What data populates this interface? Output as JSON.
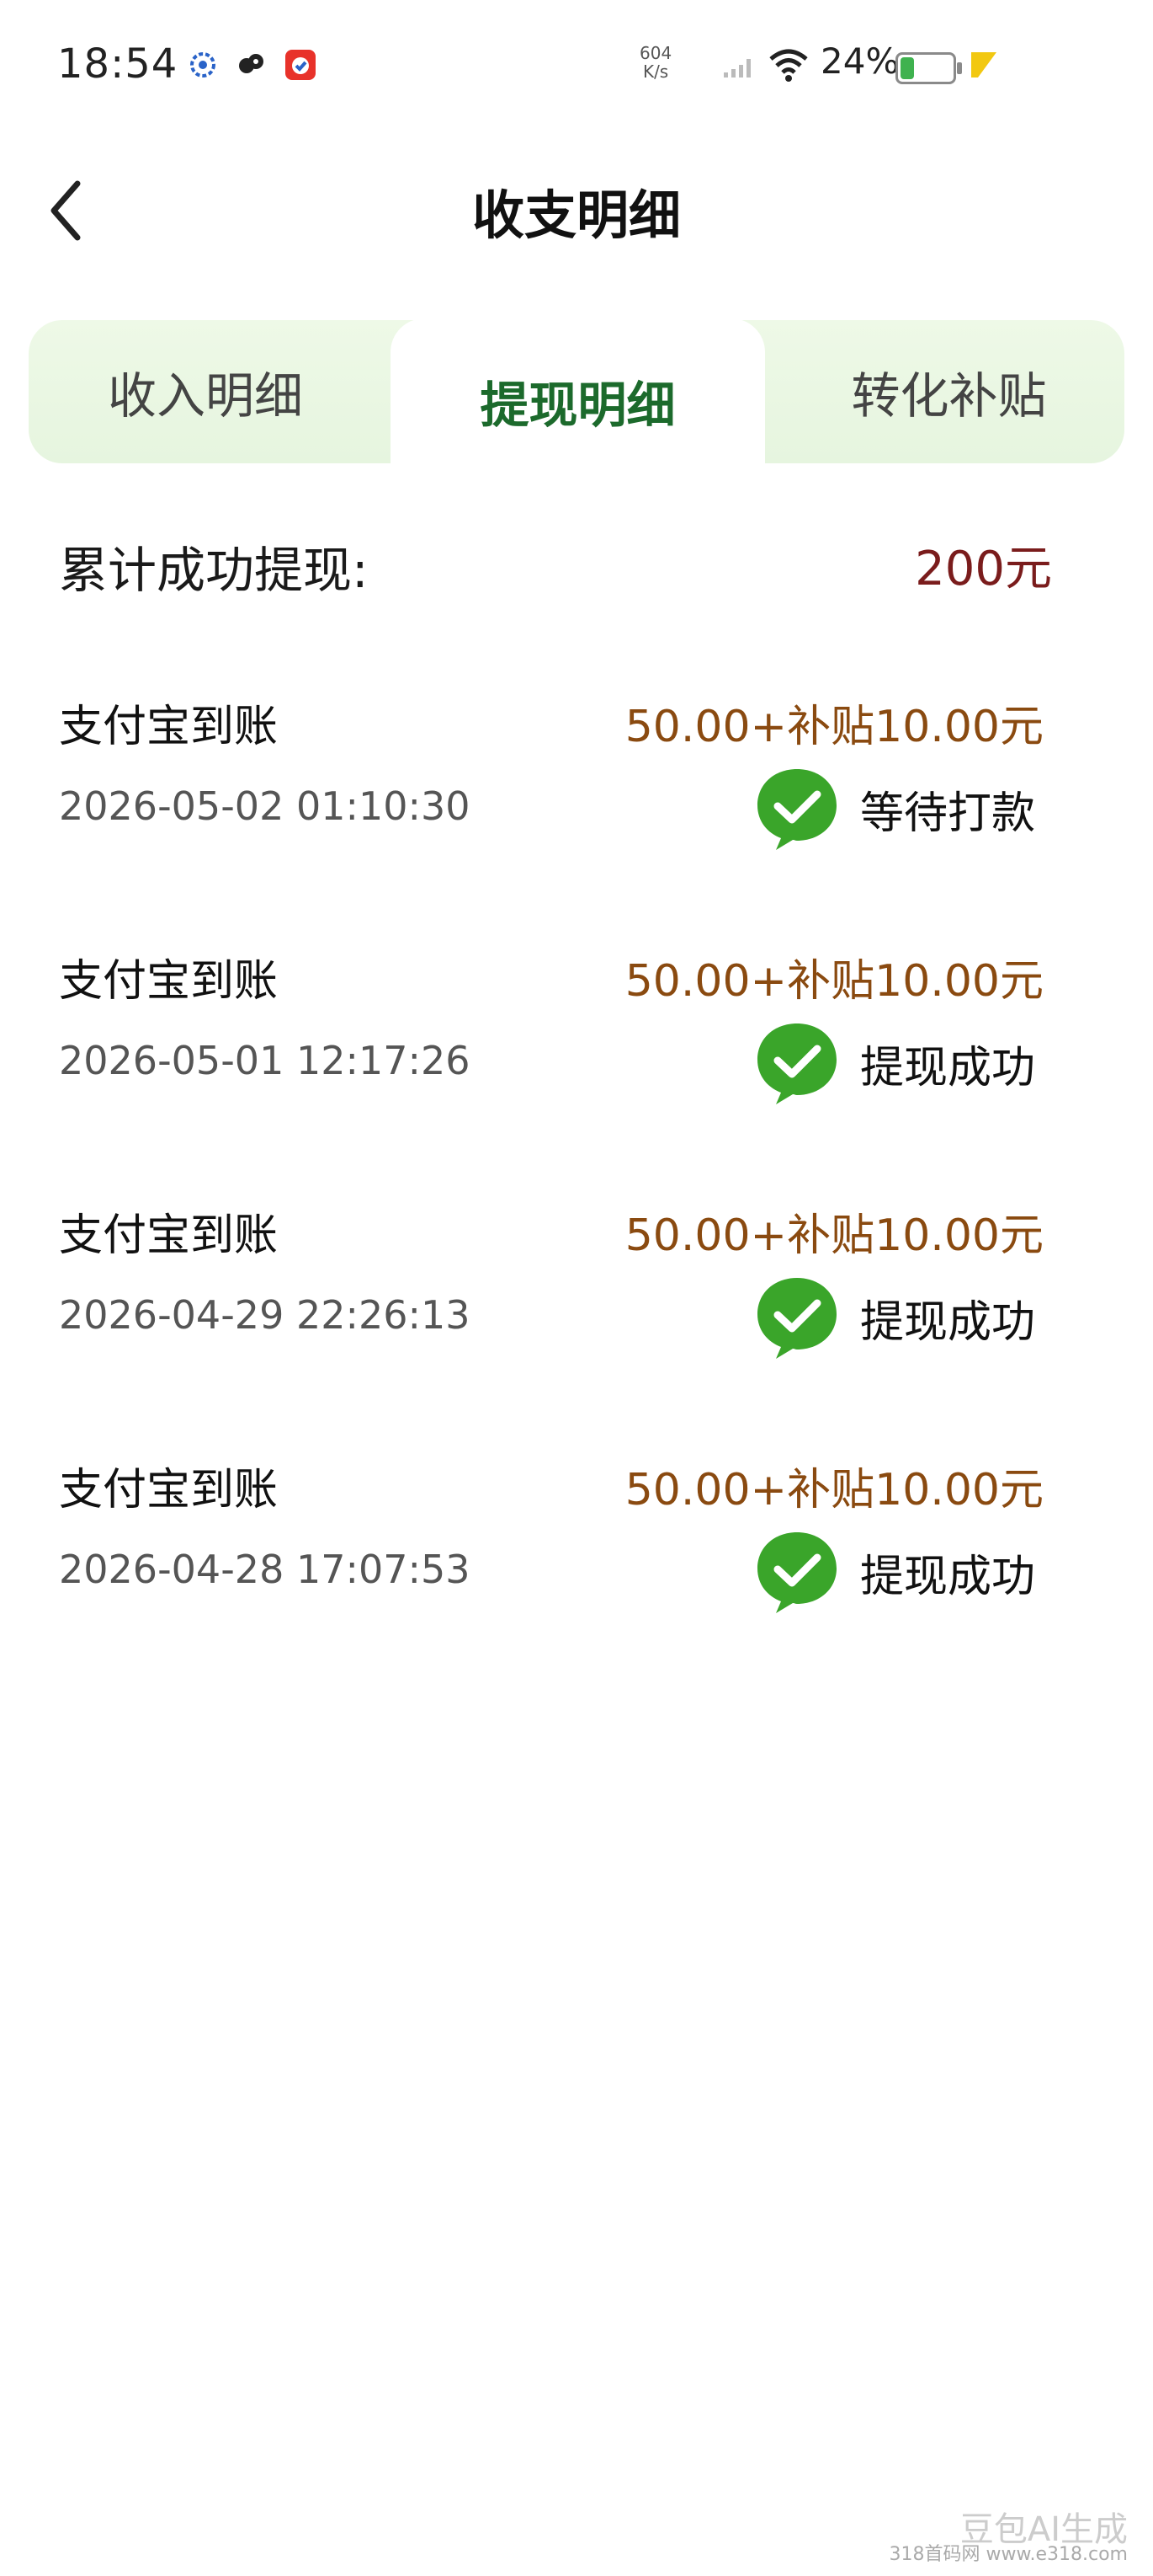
{
  "status_bar": {
    "time": "18:54",
    "net_speed_top": "604",
    "net_speed_bottom": "K/s",
    "battery": "24%",
    "icons": [
      "app-icon-1",
      "app-icon-2",
      "app-icon-3",
      "signal-icon",
      "wifi-icon",
      "battery-icon",
      "charging-icon"
    ]
  },
  "header": {
    "title": "收支明细",
    "back_icon": "chevron-left-icon"
  },
  "tabs": [
    {
      "label": "收入明细",
      "active": false
    },
    {
      "label": "提现明细",
      "active": true
    },
    {
      "label": "转化补贴",
      "active": false
    }
  ],
  "total": {
    "label": "累计成功提现:",
    "value": "200元"
  },
  "records": [
    {
      "title": "支付宝到账",
      "time": "2026-05-02 01:10:30",
      "amount": "50.00+补贴10.00元",
      "status": "等待打款"
    },
    {
      "title": "支付宝到账",
      "time": "2026-05-01 12:17:26",
      "amount": "50.00+补贴10.00元",
      "status": "提现成功"
    },
    {
      "title": "支付宝到账",
      "time": "2026-04-29 22:26:13",
      "amount": "50.00+补贴10.00元",
      "status": "提现成功"
    },
    {
      "title": "支付宝到账",
      "time": "2026-04-28 17:07:53",
      "amount": "50.00+补贴10.00元",
      "status": "提现成功"
    }
  ],
  "watermark": {
    "line1": "豆包AI生成",
    "line2": "318首码网 www.e318.com"
  },
  "colors": {
    "accent_green": "#1c6a2c",
    "amount_brown": "#8a4a10",
    "total_red": "#7a1c1c",
    "check_green": "#3aa52a"
  }
}
